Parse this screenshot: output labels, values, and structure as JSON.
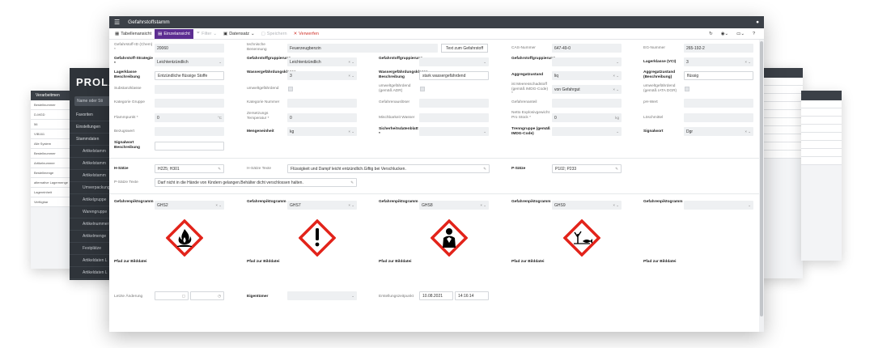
{
  "bg": {
    "brand": "PROLA",
    "search_placeholder": "Name oder Sti",
    "items": [
      "Favoriten",
      "Einstellungen",
      "Stammdaten",
      "Artikelstamm",
      "Artikelstamm",
      "Artikelstamm",
      "Umverpackung",
      "Artikelgruppe",
      "Warengruppe",
      "Artikelnummer",
      "Artikelmenge",
      "Festplätze",
      "Artikeldaten L",
      "Artikeldaten L"
    ],
    "left_title": "Verarbeitmen",
    "left_rows": [
      "Bestellnummer",
      "D-MGD",
      "56",
      "VIB161",
      "Alle  System",
      "Bestellnummer",
      "Artikelnummer",
      "Bestellmenge",
      "alternative Lagermenge",
      "Lagereinheit",
      "Verfügbar"
    ]
  },
  "window": {
    "title": "Gefahrstoffstamm",
    "toolbar": {
      "table_view": "Tabellenansicht",
      "single_view": "Einzelansicht",
      "filter": "Filter",
      "record": "Datensatz",
      "save": "Speichern",
      "discard": "Verwerfen"
    }
  },
  "form": {
    "r1": {
      "id_label": "Gefahrstoff-ID (Chem) *",
      "id_value": "20060",
      "name_label": "technische Benennung",
      "name_value": "Feuerzeugbenzin",
      "text_button": "Text zum Gefahrstoff",
      "cas_label": "CAS-Nummer",
      "cas_value": "647-49-0",
      "eg_label": "EG-Nummer",
      "eg_value": "265-192-2"
    },
    "r2": {
      "strategy_label": "Gefahrstoff-Strategie *",
      "strategy_value": "Leichtentzündlich",
      "group_label": "Gefahrstoffgruppierung",
      "group_value": "Leichtentzündlich",
      "group2_label": "Gefahrstoffgruppierung",
      "group2_value": "",
      "group3_label": "Gefahrstoffgruppierung",
      "group3_value": "",
      "lagerklasse_label": "Lagerklasse (VCI)",
      "lagerklasse_value": "3"
    },
    "r3": {
      "lk_desc_label": "Lagerklasse Beschreibung",
      "lk_desc_value": "Entzündliche flüssige Stoffe",
      "wgk_label": "Wassergefährdungsklasse",
      "wgk_value": "3",
      "wgk_desc_label": "Wassergefährdungsklasse Beschreibung",
      "wgk_desc_value": "stark wassergefährdend",
      "aggr_label": "Aggregatzustand",
      "aggr_value": "liq",
      "aggr_desc_label": "Aggregatzustand (Beschreibung)",
      "aggr_desc_value": "flüssig"
    },
    "r4": {
      "subst_label": "Substanzklasse",
      "env_label": "umweltgefährdend",
      "env_adr_label": "umweltgefährdend (gemäß ADR)",
      "marine_label": "ist Meeresschadstoff (gemäß IMDG-Code) *",
      "marine_value": "von Gefahrgut",
      "env_iata_label": "umweltgefährdend (gemäß IATA DGR)"
    },
    "r5": {
      "kg_label": "Kategorie Gruppe",
      "kn_label": "Kategorie Nummer",
      "gs_label": "Gefahrenauslöser",
      "ga_label": "Gefahrenanteil",
      "ph_label": "pH-Wert"
    },
    "r6": {
      "flash_label": "Flammpunkt *",
      "flash_value": "0",
      "flash_unit": "°C",
      "decomp_label": "Zersetzungs Temperatur *",
      "decomp_value": "0",
      "misch_label": "Mischbarkeit Wasser",
      "netto_label": "Netto Explosivgewicht Pro Stück *",
      "netto_value": "0",
      "netto_unit": "kg",
      "loesch_label": "Löschmittel"
    },
    "r7": {
      "bezug_label": "Bezugswert",
      "me_label": "Mengeneinheit",
      "me_value": "kg",
      "sdb_label": "Sicherheitsdatenblatt *",
      "tg_label": "Trenngruppe (gemäß IMDG-Code)",
      "sw_label": "Signalwort",
      "sw_value": "Dgr"
    },
    "r8": {
      "swb_label": "Signalwort Beschreibung"
    },
    "hsaetze_label": "H-Sätze",
    "hsaetze_value": "H225; H301",
    "htexte_label": "H-Sätze Texte",
    "htexte_value": "Flüssigkeit und Dampf leicht entzündlich.Giftig bei Verschlucken.",
    "psaetze_label": "P-Sätze",
    "psaetze_value": "P102; P233",
    "ptexte_label": "P-Sätze Texte",
    "ptexte_value": "Darf nicht in die Hände von Kindern gelangen.Behälter dicht verschlossen halten.",
    "pictograms": [
      {
        "label": "Gefahrenpiktogramm",
        "value": "GHS2",
        "path_label": "Pfad zur Bilddatei",
        "icon": "flame-icon"
      },
      {
        "label": "Gefahrenpiktogramm",
        "value": "GHS7",
        "path_label": "Pfad zur Bilddatei",
        "icon": "exclamation-icon"
      },
      {
        "label": "Gefahrenpiktogramm",
        "value": "GHS8",
        "path_label": "Pfad zur Bilddatei",
        "icon": "health-hazard-icon"
      },
      {
        "label": "Gefahrenpiktogramm",
        "value": "GHS9",
        "path_label": "Pfad zur Bilddatei",
        "icon": "environment-icon"
      },
      {
        "label": "Gefahrenpiktogramm",
        "value": "",
        "path_label": "Pfad zur Bilddatei",
        "icon": ""
      }
    ],
    "footer": {
      "last_change_label": "Letzte Änderung",
      "owner_label": "Eigentümer",
      "created_label": "Erstellungszeitpunkt",
      "created_date": "10.08.2021",
      "created_time": "14:16:14"
    }
  },
  "colors": {
    "accent": "#5c2d91",
    "titlebar": "#3b4047",
    "ghs_red": "#e2231a",
    "discard": "#d0342c"
  }
}
